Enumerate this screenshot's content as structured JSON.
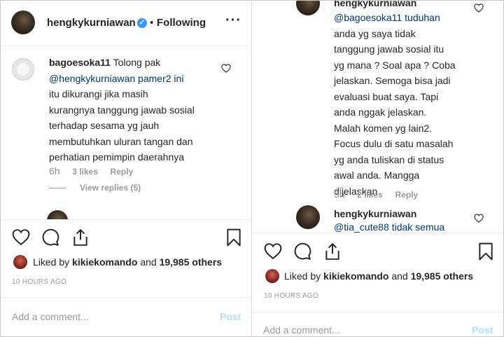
{
  "left": {
    "header": {
      "username": "hengkykurniawan",
      "separator": "•",
      "follow_status": "Following",
      "more_label": "···"
    },
    "comment": {
      "username": "bagoesoka11",
      "lines": [
        "Tolong pak",
        "@hengkykurniawan pamer2 ini",
        "itu dikurangi jika masih",
        "kurangnya tanggung jawab sosial",
        "terhadap sesama yg jauh",
        "membutuhkan uluran tangan dan",
        "perhatian pemimpin daerahnya"
      ],
      "time": "6h",
      "likes": "3 likes",
      "reply": "Reply",
      "view_replies": "View replies (5)"
    },
    "liked_by": {
      "prefix": "Liked by",
      "user": "kikiekomando",
      "middle": "and",
      "count": "19,985 others"
    },
    "timestamp": "10 HOURS AGO",
    "add_comment_placeholder": "Add a comment...",
    "post_label": "Post"
  },
  "right": {
    "top_username": "hengkykurniawan",
    "reply": {
      "lines": [
        "@bagoesoka11 tuduhan",
        "anda yg saya tidak",
        "tanggung jawab sosial itu",
        "yg mana ? Soal apa ? Coba",
        "jelaskan. Semoga bisa jadi",
        "evaluasi buat saya. Tapi",
        "anda nggak jelaskan.",
        "Malah komen yg lain2.",
        "Focus dulu di satu masalah",
        "yg anda tuliskan di status",
        "awal anda. Mangga",
        "dijelaskan"
      ],
      "time": "5h",
      "likes": "2 likes",
      "reply": "Reply"
    },
    "next_comment": {
      "username": "hengkykurniawan",
      "text": "@tia_cute88 tidak semua"
    },
    "liked_by": {
      "prefix": "Liked by",
      "user": "kikiekomando",
      "middle": "and",
      "count": "19,985 others"
    },
    "timestamp": "10 HOURS AGO",
    "add_comment_placeholder": "Add a comment...",
    "post_label": "Post"
  },
  "icons": [
    "heart-icon",
    "comment-icon",
    "share-icon",
    "bookmark-icon",
    "verified-icon",
    "more-icon"
  ]
}
